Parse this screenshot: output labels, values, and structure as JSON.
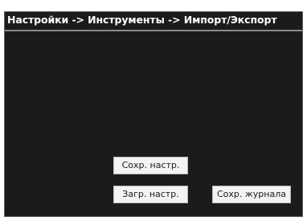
{
  "header": {
    "title": "Настройки -> Инструменты -> Импорт/Экспорт"
  },
  "actions": {
    "save_settings_label": "Сохр. настр.",
    "load_settings_label": "Загр. настр.",
    "save_log_label": "Сохр. журнала"
  },
  "colors": {
    "panel_background": "#1b1b1b",
    "title_text": "#ffffff",
    "button_background": "#f3f3f3",
    "divider": "#8a8a8a"
  }
}
